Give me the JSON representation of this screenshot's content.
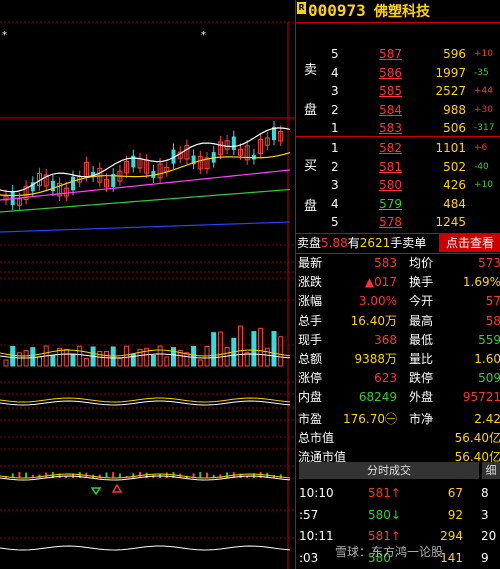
{
  "stock": {
    "badge": "R",
    "code": "000973",
    "name": "佛塑科技"
  },
  "sell_side_label": "卖\n盘",
  "buy_side_label": "买\n盘",
  "sell_orders": [
    {
      "level": "5",
      "price": "587",
      "volume": "596",
      "change": "+10",
      "dir": "up"
    },
    {
      "level": "4",
      "price": "586",
      "volume": "1997",
      "change": "-35",
      "dir": "down"
    },
    {
      "level": "3",
      "price": "585",
      "volume": "2527",
      "change": "+44",
      "dir": "up"
    },
    {
      "level": "2",
      "price": "584",
      "volume": "988",
      "change": "+30",
      "dir": "up"
    },
    {
      "level": "1",
      "price": "583",
      "volume": "506",
      "change": "-317",
      "dir": "down"
    }
  ],
  "buy_orders": [
    {
      "level": "1",
      "price": "582",
      "volume": "1101",
      "change": "+6",
      "dir": "up"
    },
    {
      "level": "2",
      "price": "581",
      "volume": "502",
      "change": "-40",
      "dir": "down"
    },
    {
      "level": "3",
      "price": "580",
      "volume": "426",
      "change": "+10",
      "dir": "down"
    },
    {
      "level": "4",
      "price": "579",
      "volume": "484",
      "change": "",
      "dir": "up"
    },
    {
      "level": "5",
      "price": "578",
      "volume": "1245",
      "change": "",
      "dir": "up"
    }
  ],
  "order_summary": {
    "text": "卖盘5.88有2621手卖单",
    "rest_button": "点击查看"
  },
  "stats": [
    {
      "l1": "最新",
      "v1": "583",
      "c1": "red",
      "l2": "均价",
      "v2": "573",
      "c2": "red"
    },
    {
      "l1": "涨跌",
      "v1": "▲017",
      "c1": "red",
      "l2": "换手",
      "v2": "1.69%",
      "c2": "yel"
    },
    {
      "l1": "涨幅",
      "v1": "3.00%",
      "c1": "red",
      "l2": "今开",
      "v2": "57",
      "c2": "red"
    },
    {
      "l1": "总手",
      "v1": "16.40万",
      "c1": "yel",
      "l2": "最高",
      "v2": "58",
      "c2": "red"
    },
    {
      "l1": "现手",
      "v1": "368",
      "c1": "red",
      "l2": "最低",
      "v2": "559",
      "c2": "grn"
    },
    {
      "l1": "总额",
      "v1": "9388万",
      "c1": "yel",
      "l2": "量比",
      "v2": "1.60",
      "c2": "yel"
    },
    {
      "l1": "涨停",
      "v1": "623",
      "c1": "red",
      "l2": "跌停",
      "v2": "509",
      "c2": "grn"
    },
    {
      "l1": "内盘",
      "v1": "68249",
      "c1": "grn",
      "l2": "外盘",
      "v2": "95721",
      "c2": "red"
    },
    {
      "l1": "市盈",
      "v1": "176.70㊀",
      "c1": "yel",
      "l2": "市净",
      "v2": "2.42",
      "c2": "yel"
    },
    {
      "l1": "总市值",
      "v1": "",
      "c1": "yel",
      "l2": "",
      "v2": "56.40亿",
      "c2": "yel"
    },
    {
      "l1": "流通市值",
      "v1": "",
      "c1": "yel",
      "l2": "",
      "v2": "56.40亿",
      "c2": "yel"
    }
  ],
  "ticks": {
    "title": "分时成交",
    "tab": "细",
    "rows": [
      {
        "time": "10:10",
        "price": "581↑",
        "color": "red",
        "volume": "67",
        "num": "8"
      },
      {
        "time": ":57",
        "price": "580↓",
        "color": "grn",
        "volume": "92",
        "num": "3"
      },
      {
        "time": "10:11",
        "price": "581↑",
        "color": "red",
        "volume": "294",
        "num": "20"
      },
      {
        "time": ":03",
        "price": "580",
        "color": "grn",
        "volume": "141",
        "num": "9"
      }
    ]
  },
  "watermark": "雪球：东方鸿一论股",
  "colors": {
    "up": "#ff3333",
    "down": "#33cc33",
    "accent": "#ffd200",
    "grid": "#cc0000"
  }
}
